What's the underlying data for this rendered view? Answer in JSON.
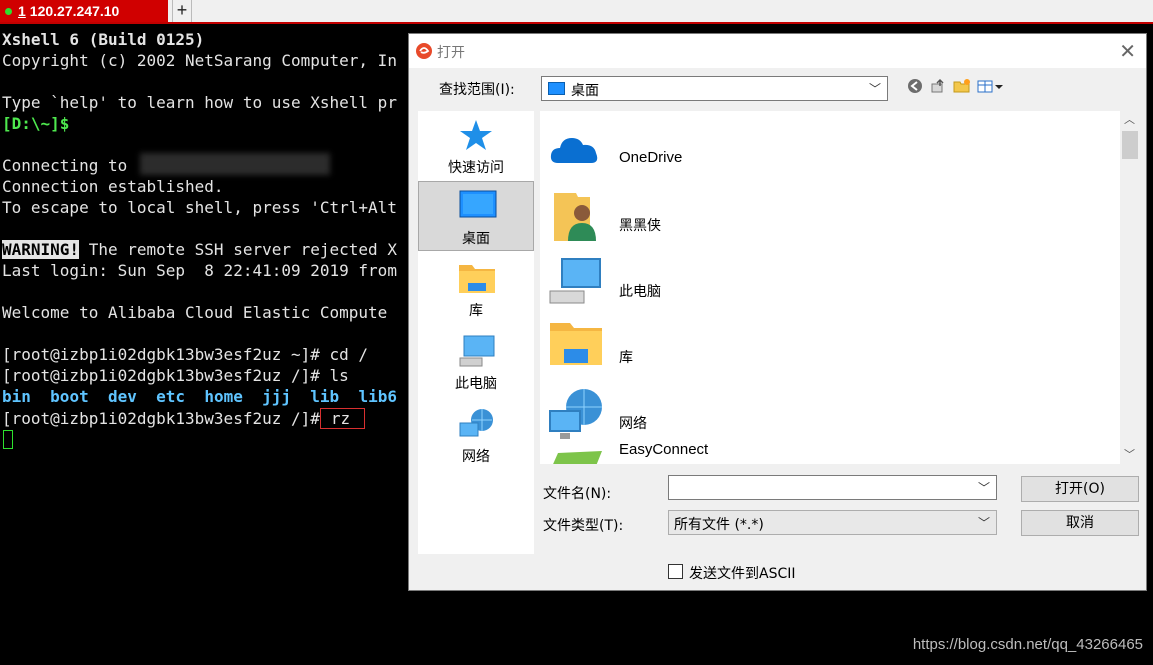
{
  "tab": {
    "number": "1",
    "host": "120.27.247.10",
    "add": "+"
  },
  "terminal": {
    "line1": "Xshell 6 (Build 0125)",
    "line2": "Copyright (c) 2002 NetSarang Computer, In",
    "line3": "Type `help' to learn how to use Xshell pr",
    "prompt_local": "[D:\\~]$",
    "line5": "Connecting to",
    "line6": "Connection established.",
    "line7": "To escape to local shell, press 'Ctrl+Alt",
    "warning_tag": "WARNING!",
    "warning_rest": " The remote SSH server rejected X",
    "last_login": "Last login: Sun Sep  8 22:41:09 2019 from",
    "welcome": "Welcome to Alibaba Cloud Elastic Compute",
    "cmd_cd": "[root@izbp1i02dgbk13bw3esf2uz ~]# cd /",
    "cmd_ls": "[root@izbp1i02dgbk13bw3esf2uz /]# ls",
    "ls_items": [
      "bin",
      "boot",
      "dev",
      "etc",
      "home",
      "jjj",
      "lib",
      "lib6"
    ],
    "prompt_rz": "[root@izbp1i02dgbk13bw3esf2uz /]#",
    "cmd_rz": "rz"
  },
  "dialog": {
    "title": "打开",
    "close": "✕",
    "lookin_label": "查找范围(I):",
    "lookin_value": "桌面",
    "places": [
      {
        "label": "快速访问",
        "icon": "star-icon"
      },
      {
        "label": "桌面",
        "icon": "desktop-icon"
      },
      {
        "label": "库",
        "icon": "library-icon"
      },
      {
        "label": "此电脑",
        "icon": "computer-icon"
      },
      {
        "label": "网络",
        "icon": "network-icon"
      }
    ],
    "files": [
      {
        "name": "OneDrive",
        "icon": "onedrive-icon"
      },
      {
        "name": "黑黑侠",
        "icon": "user-folder-icon"
      },
      {
        "name": "此电脑",
        "icon": "computer-icon"
      },
      {
        "name": "库",
        "icon": "library-icon"
      },
      {
        "name": "网络",
        "icon": "network-icon"
      },
      {
        "name": "EasyConnect",
        "icon": "shortcut-icon"
      }
    ],
    "filename_label": "文件名(N):",
    "filename_value": "",
    "filetype_label": "文件类型(T):",
    "filetype_value": "所有文件 (*.*)",
    "open_button": "打开(O)",
    "cancel_button": "取消",
    "ascii_label": "发送文件到ASCII",
    "ascii_checked": false
  },
  "watermark": "https://blog.csdn.net/qq_43266465",
  "colors": {
    "tab_red": "#d00000",
    "prompt_green": "#4ee84e",
    "ls_blue": "#5fc4ff",
    "rz_border": "#d83030"
  }
}
